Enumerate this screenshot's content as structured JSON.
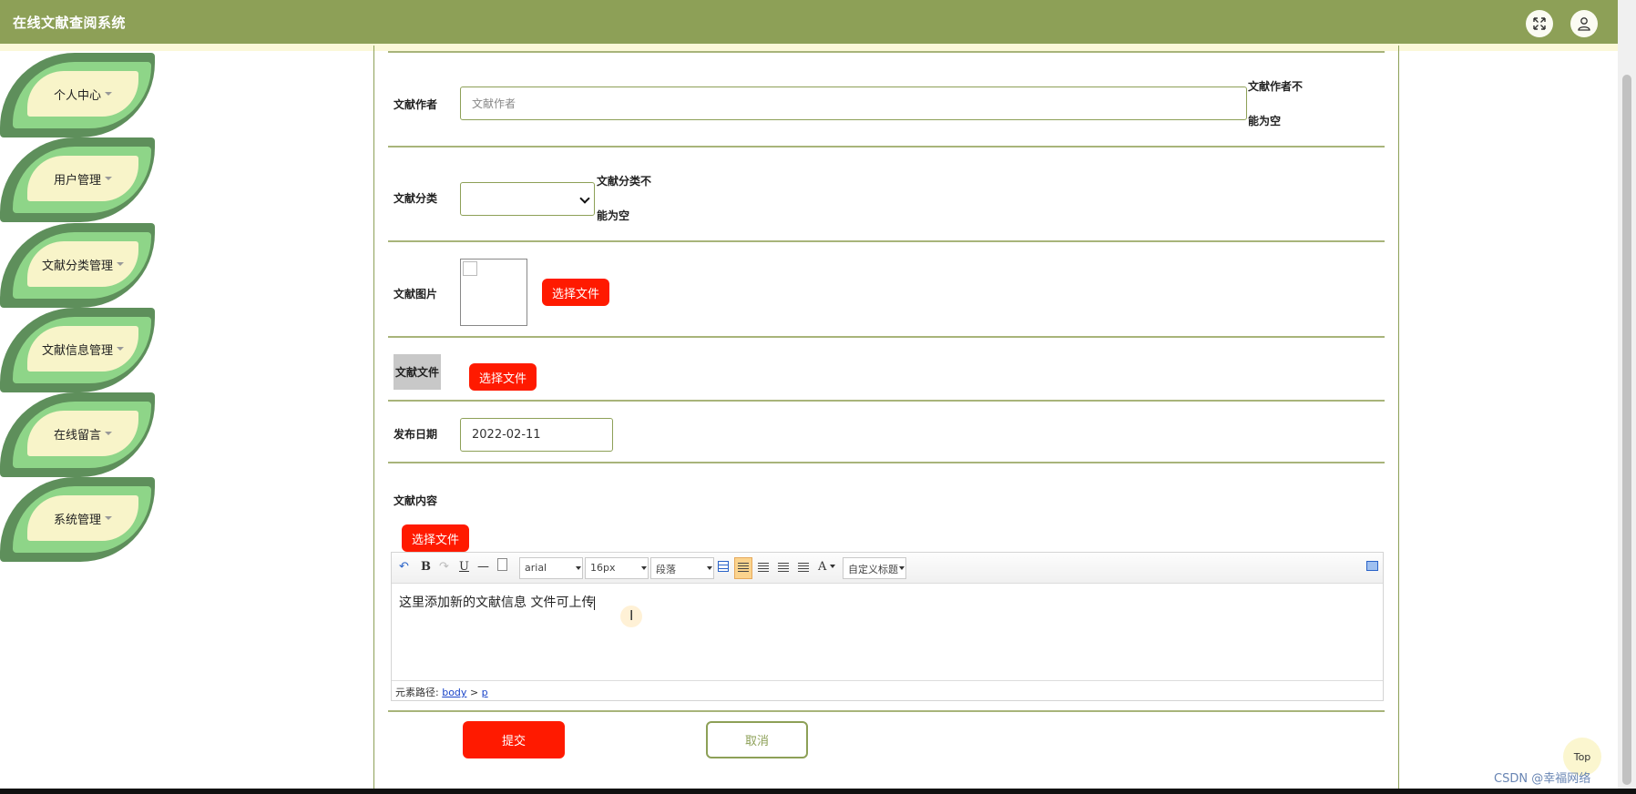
{
  "header": {
    "title": "在线文献查阅系统"
  },
  "sidebar": {
    "items": [
      {
        "label": "个人中心"
      },
      {
        "label": "用户管理"
      },
      {
        "label": "文献分类管理"
      },
      {
        "label": "文献信息管理"
      },
      {
        "label": "在线留言"
      },
      {
        "label": "系统管理"
      }
    ]
  },
  "form": {
    "author": {
      "label": "文献作者",
      "placeholder": "文献作者",
      "error_1": "文献作者不",
      "error_2": "能为空"
    },
    "category": {
      "label": "文献分类",
      "error_1": "文献分类不",
      "error_2": "能为空"
    },
    "image": {
      "label": "文献图片",
      "button": "选择文件"
    },
    "file": {
      "label": "文献文件",
      "button": "选择文件"
    },
    "publish_date": {
      "label": "发布日期",
      "value": "2022-02-11"
    },
    "content": {
      "label": "文献内容",
      "upload_button": "选择文件",
      "toolbar": {
        "font_family": "arial",
        "font_size": "16px",
        "paragraph": "段落",
        "custom_heading": "自定义标题",
        "font_color_glyph": "A"
      },
      "body_text": "这里添加新的文献信息  文件可上传",
      "status_label": "元素路径:",
      "path_body": "body",
      "path_sep": ">",
      "path_p": "p"
    },
    "submit": "提交",
    "cancel": "取消"
  },
  "misc": {
    "top_button": "Top",
    "watermark": "CSDN @幸福网络"
  },
  "colors": {
    "header_bg": "#8da057",
    "accent_red": "#ff1a00",
    "leaf_dark": "#5e8f5b",
    "leaf_light": "#8ed588",
    "leaf_center": "#f8f4c9"
  }
}
